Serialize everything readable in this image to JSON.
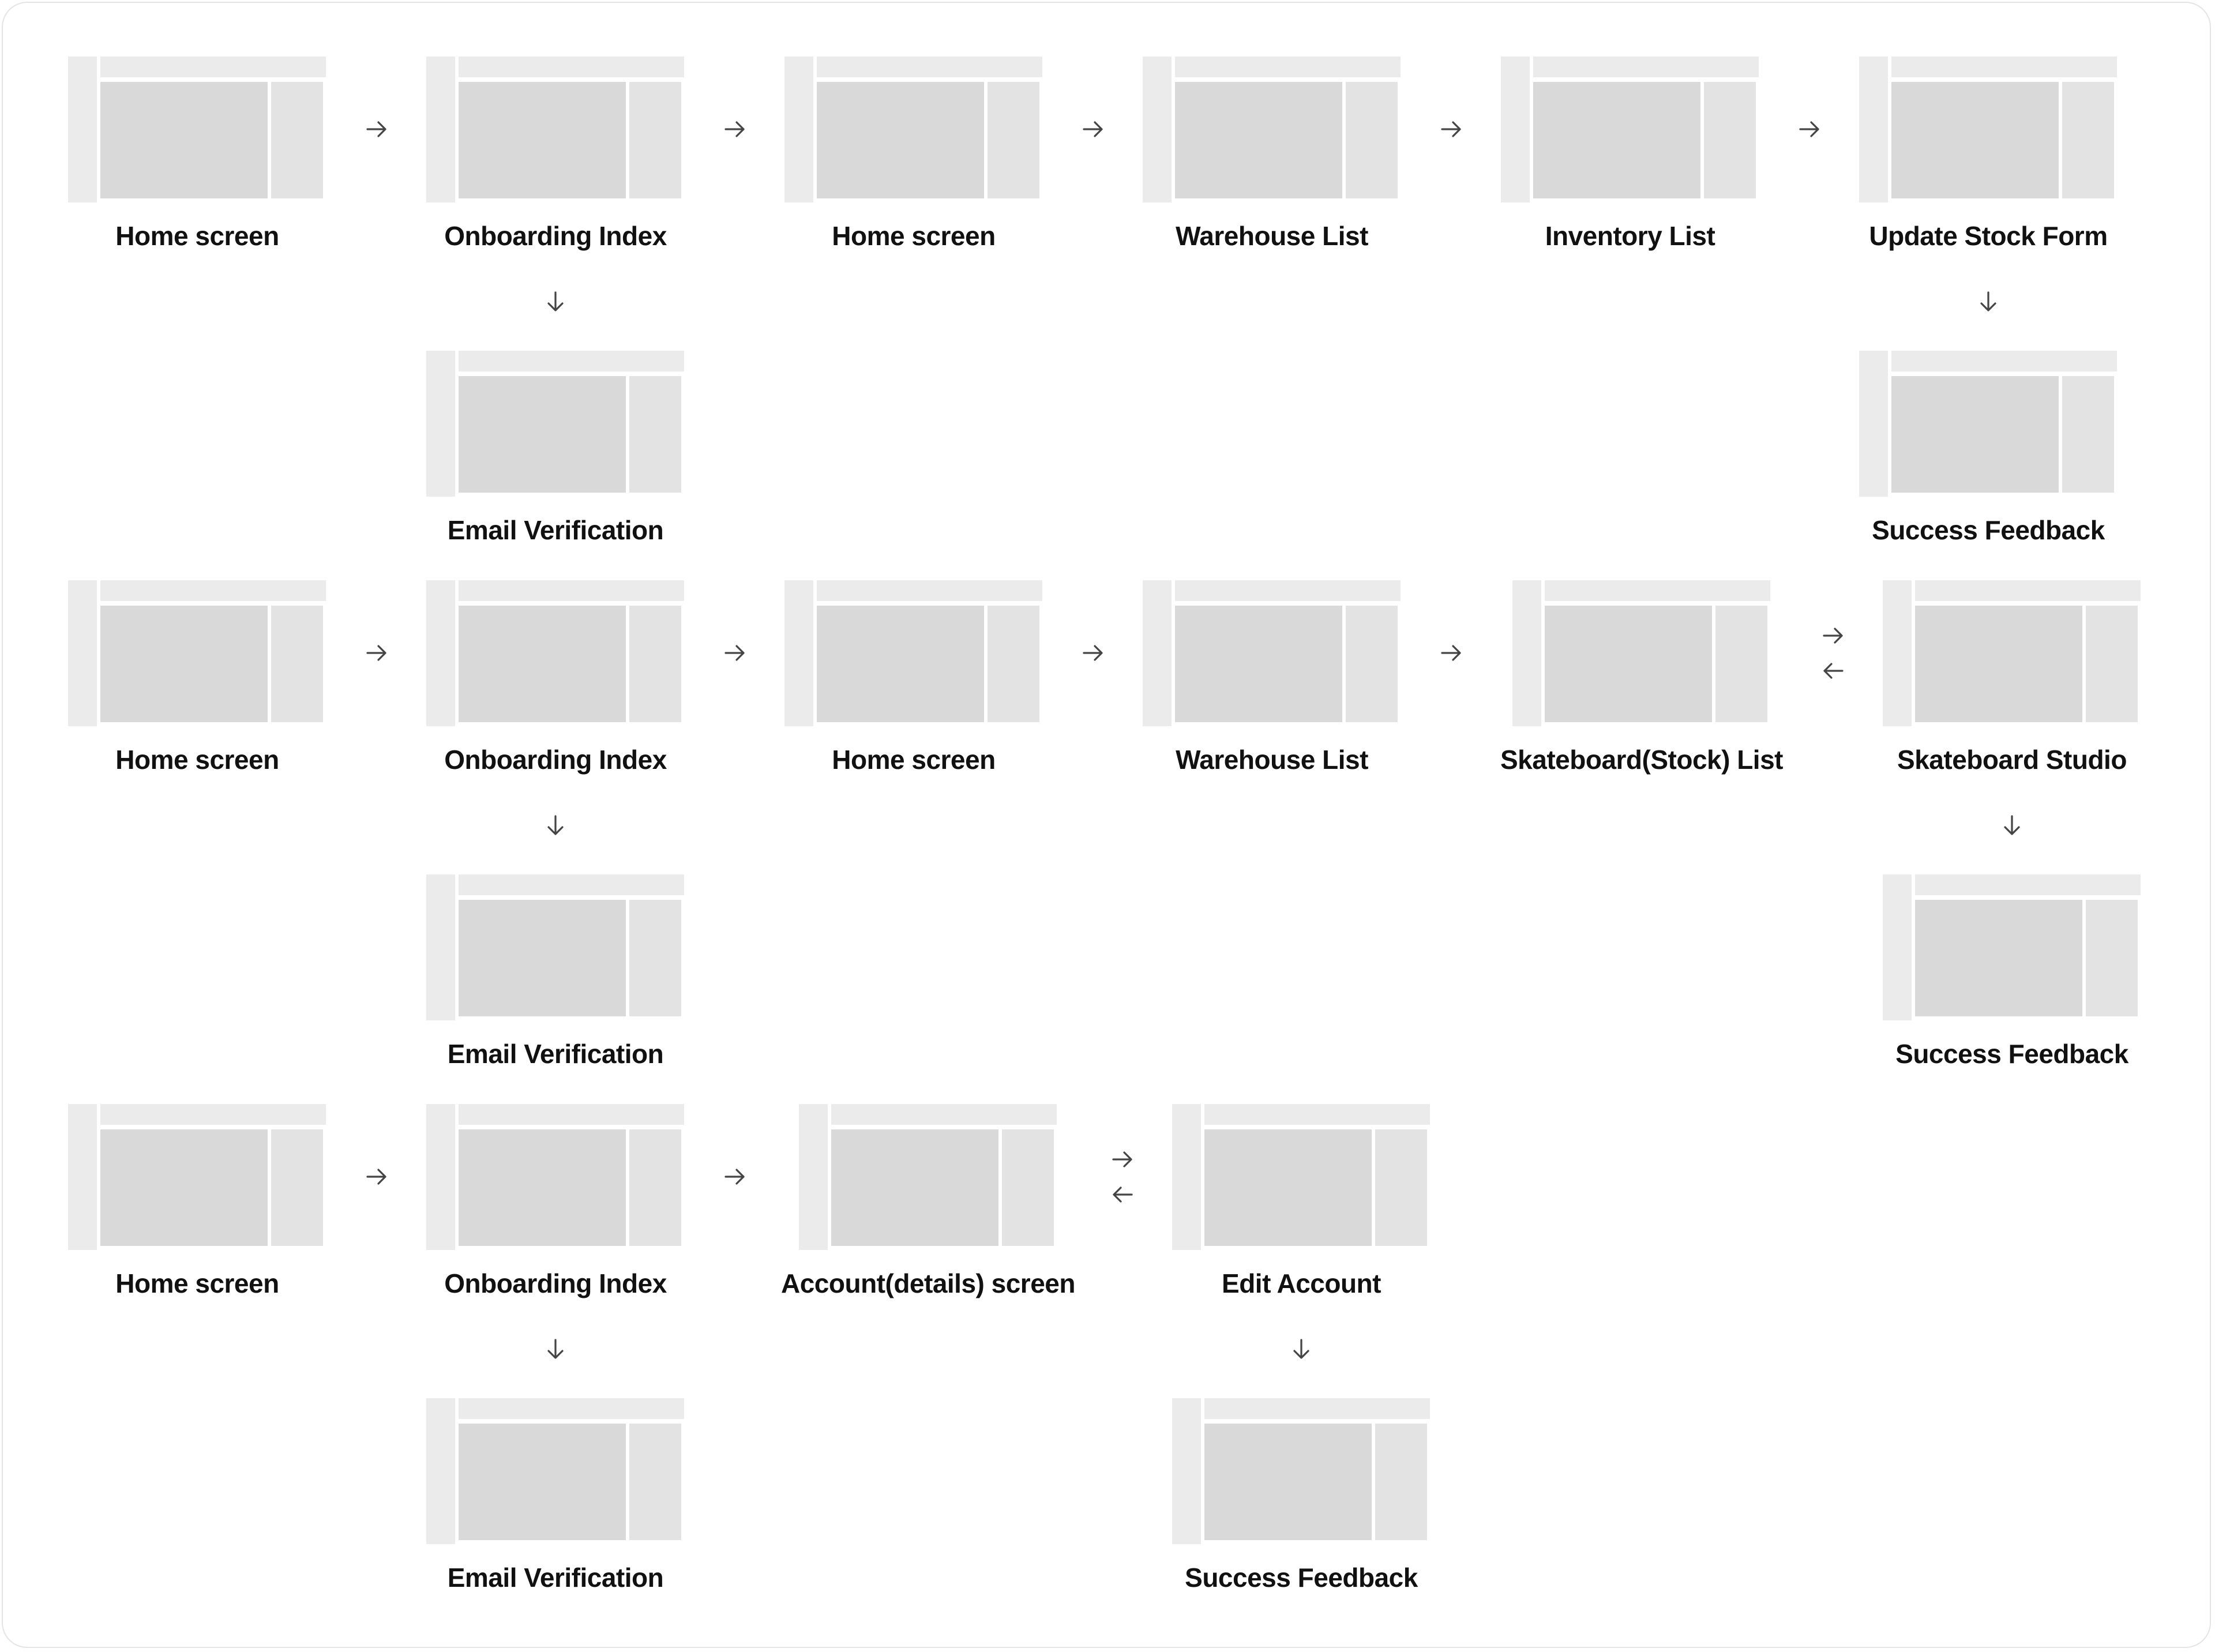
{
  "rows": [
    {
      "labels": [
        "Home screen",
        "Onboarding Index",
        "Home screen",
        "Warehouse List",
        "Inventory List",
        "Update Stock Form"
      ],
      "branch_labels": [
        "Email Verification",
        "Success Feedback"
      ]
    },
    {
      "labels": [
        "Home screen",
        "Onboarding Index",
        "Home screen",
        "Warehouse List",
        "Skateboard(Stock) List",
        "Skateboard Studio"
      ],
      "branch_labels": [
        "Email Verification",
        "Success Feedback"
      ]
    },
    {
      "labels": [
        "Home screen",
        "Onboarding Index",
        "Account(details) screen",
        "Edit Account"
      ],
      "branch_labels": [
        "Email Verification",
        "Success Feedback"
      ]
    }
  ],
  "icons": {
    "forward": "arrow-right-icon",
    "backward": "arrow-left-icon",
    "down": "arrow-down-icon"
  },
  "colors": {
    "sidebar": "#ebebeb",
    "topbar": "#ebebeb",
    "content": "#d9d9d9",
    "panel": "#e3e3e3",
    "label": "#111111",
    "arrow": "#444444",
    "frame_border": "#e4e4e4"
  }
}
